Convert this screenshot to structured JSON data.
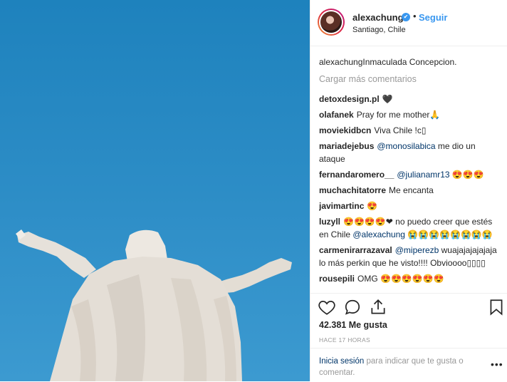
{
  "header": {
    "username": "alexachung",
    "verified_icon": "✔",
    "separator": "•",
    "follow_label": "Seguir",
    "location": "Santiago, Chile"
  },
  "caption": {
    "user": "alexachung",
    "text": "Inmaculada Concepcion."
  },
  "load_more_label": "Cargar más comentarios",
  "comments": [
    {
      "user": "detoxdesign.pl",
      "text": "🖤",
      "mention": ""
    },
    {
      "user": "olafanek",
      "text": "Pray for me mother🙏",
      "mention": ""
    },
    {
      "user": "moviekidbcn",
      "text": "Viva Chile !c▯",
      "mention": ""
    },
    {
      "user": "mariadejebus",
      "mention": "@monosilabica",
      "text": " me dio un ataque"
    },
    {
      "user": "fernandaromero__",
      "mention": "@julianamr13",
      "text": " 😍😍😍"
    },
    {
      "user": "muchachitatorre",
      "text": "Me encanta",
      "mention": ""
    },
    {
      "user": "javimartinc",
      "text": "😍",
      "mention": ""
    },
    {
      "user": "luzyll",
      "text": "😍😍😍😍❤ no puedo creer que estés en Chile ",
      "mention": "@alexachung",
      "text2": " 😭😭😭😭😭😭😭😭"
    },
    {
      "user": "carmenirarrazaval",
      "mention": "@miperezb",
      "text": " wuajajajajajaja lo más perkin que he visto!!!! Obvioooo▯▯▯▯"
    },
    {
      "user": "rousepili",
      "text": "OMG 😍😍😍😍😍😍",
      "mention": ""
    }
  ],
  "likes": "42.381 Me gusta",
  "timestamp": "HACE 17 HORAS",
  "footer": {
    "login_link": "Inicia sesión",
    "login_rest": " para indicar que te gusta o comentar.",
    "more_icon": "•••"
  },
  "icons": {
    "like": "heart-icon",
    "comment": "comment-icon",
    "share": "share-icon",
    "save": "bookmark-icon"
  }
}
